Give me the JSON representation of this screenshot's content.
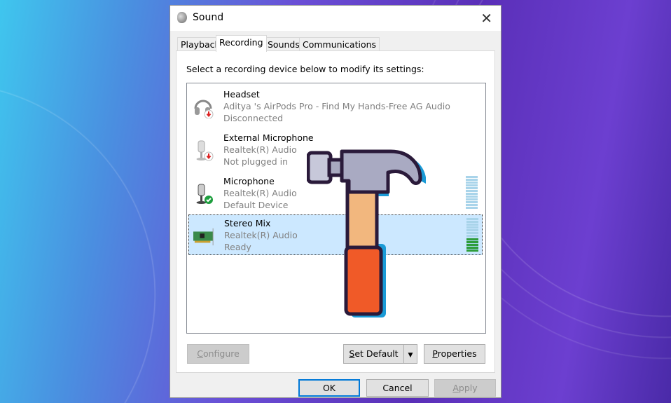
{
  "window": {
    "title": "Sound",
    "close": "✕"
  },
  "tabs": [
    {
      "label": "Playback"
    },
    {
      "label": "Recording"
    },
    {
      "label": "Sounds"
    },
    {
      "label": "Communications"
    }
  ],
  "instruction": "Select a recording device below to modify its settings:",
  "devices": [
    {
      "name": "Headset",
      "desc": "Aditya 's AirPods Pro - Find My Hands-Free AG Audio",
      "status": "Disconnected",
      "icon": "headset-icon"
    },
    {
      "name": "External Microphone",
      "desc": "Realtek(R) Audio",
      "status": "Not plugged in",
      "icon": "microphone-icon"
    },
    {
      "name": "Microphone",
      "desc": "Realtek(R) Audio",
      "status": "Default Device",
      "icon": "microphone-icon",
      "level": 0
    },
    {
      "name": "Stereo Mix",
      "desc": "Realtek(R) Audio",
      "status": "Ready",
      "icon": "sound-card-icon",
      "level": 0.4,
      "selected": true
    }
  ],
  "buttons": {
    "configure": {
      "pre": "",
      "ul": "C",
      "post": "onfigure"
    },
    "set_default": {
      "pre": "",
      "ul": "S",
      "post": "et Default"
    },
    "properties": {
      "pre": "",
      "ul": "P",
      "post": "roperties"
    },
    "ok": "OK",
    "cancel": "Cancel",
    "apply": {
      "pre": "",
      "ul": "A",
      "post": "pply"
    }
  },
  "colors": {
    "accent": "#0078d7",
    "selected": "#cce8ff",
    "meter_green": "#2e9d3a"
  }
}
